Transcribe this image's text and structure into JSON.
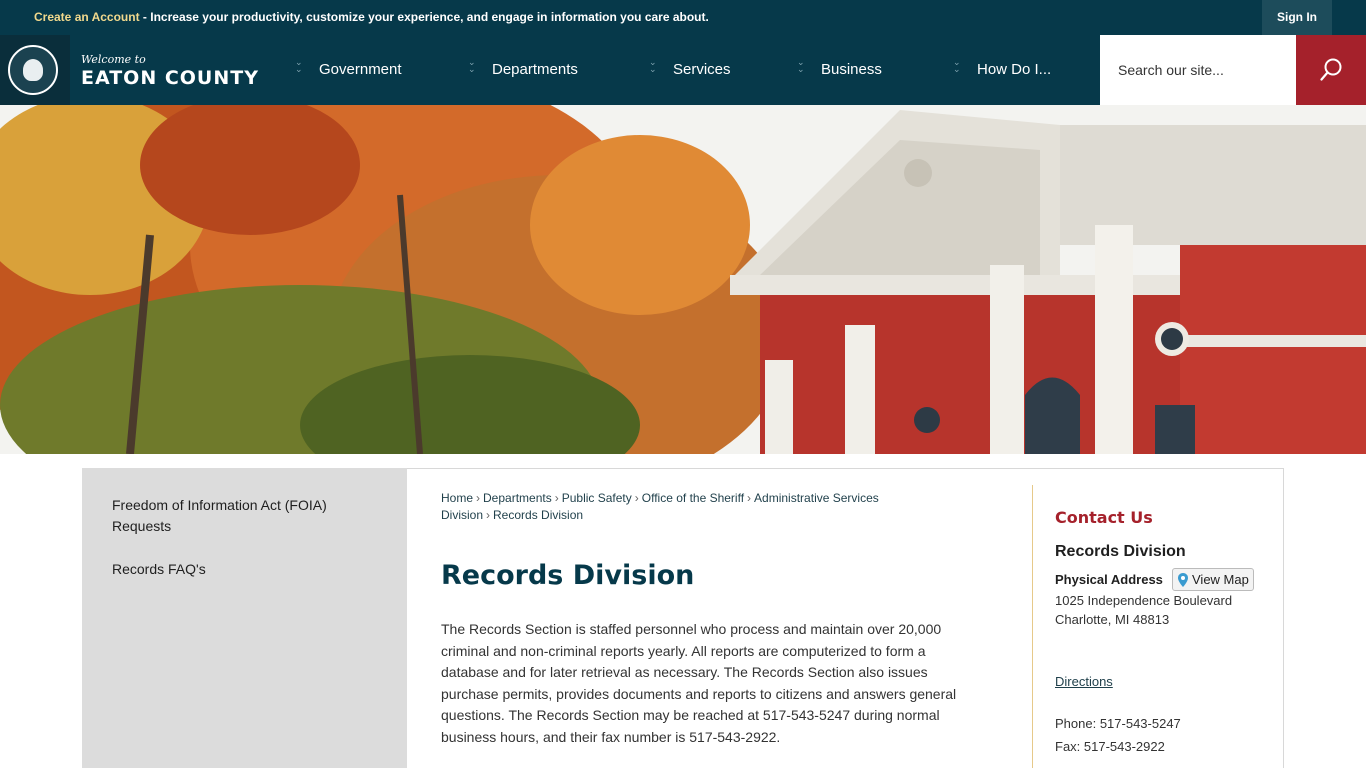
{
  "topbar": {
    "create_account": "Create an Account",
    "promo_text": " - Increase your productivity, customize your experience, and engage in information you care about.",
    "sign_in": "Sign In"
  },
  "brand": {
    "welcome": "Welcome to",
    "name": "EATON COUNTY"
  },
  "nav": {
    "items": [
      {
        "label": "Government"
      },
      {
        "label": "Departments"
      },
      {
        "label": "Services"
      },
      {
        "label": "Business"
      },
      {
        "label": "How Do I..."
      }
    ],
    "search_placeholder": "Search our site..."
  },
  "sidebar": {
    "items": [
      {
        "label": "Freedom of Information Act (FOIA) Requests"
      },
      {
        "label": "Records FAQ's"
      }
    ]
  },
  "breadcrumb": {
    "items": [
      "Home",
      "Departments",
      "Public Safety",
      "Office of the Sheriff",
      "Administrative Services Division"
    ],
    "current": "Records Division"
  },
  "page": {
    "title": "Records Division",
    "body": "The Records Section is staffed personnel who process and maintain over 20,000 criminal and non-criminal reports yearly. All reports are computerized to form a database and for later retrieval as necessary. The Records Section also issues purchase permits, provides documents and reports to citizens and answers general questions. The Records Section may be reached at 517-543-5247 during normal business hours, and their fax number is 517-543-2922."
  },
  "contact": {
    "heading": "Contact Us",
    "name": "Records Division",
    "address_label": "Physical Address",
    "view_map": "View Map",
    "address_line1": "1025 Independence Boulevard",
    "address_line2": "Charlotte, MI 48813",
    "directions": "Directions",
    "phone": "Phone: 517-543-5247",
    "fax": "Fax: 517-543-2922"
  },
  "colors": {
    "navy": "#06394a",
    "accent_red": "#a5212b",
    "gold": "#f1d98d"
  }
}
